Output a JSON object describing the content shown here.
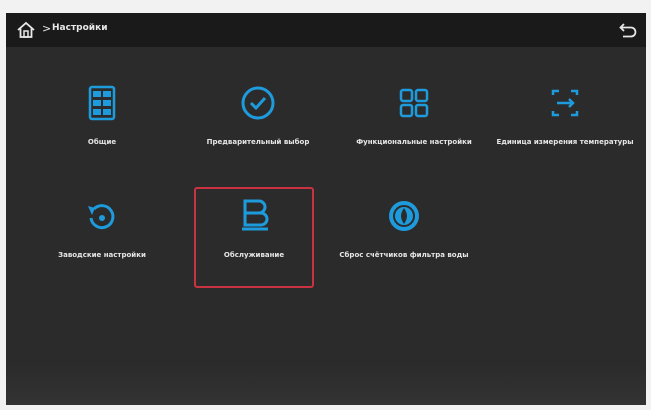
{
  "header": {
    "breadcrumb_sep": ">",
    "title": "Настройки"
  },
  "tiles": [
    {
      "label": "Общие",
      "icon": "grid-list-icon"
    },
    {
      "label": "Предварительный выбор",
      "icon": "check-circle-icon"
    },
    {
      "label": "Функциональные настройки",
      "icon": "four-squares-icon"
    },
    {
      "label": "Единица измерения температуры",
      "icon": "temperature-unit-icon"
    },
    {
      "label": "Заводские настройки",
      "icon": "reset-arrow-icon"
    },
    {
      "label": "Обслуживание",
      "icon": "maintenance-icon",
      "selected": true
    },
    {
      "label": "Сброс счётчиков фильтра воды",
      "icon": "filter-reset-icon"
    }
  ],
  "colors": {
    "accent": "#1e9bdc",
    "selection": "#c93240",
    "background": "#2b2b2b",
    "topbar": "#1a1a1a"
  }
}
